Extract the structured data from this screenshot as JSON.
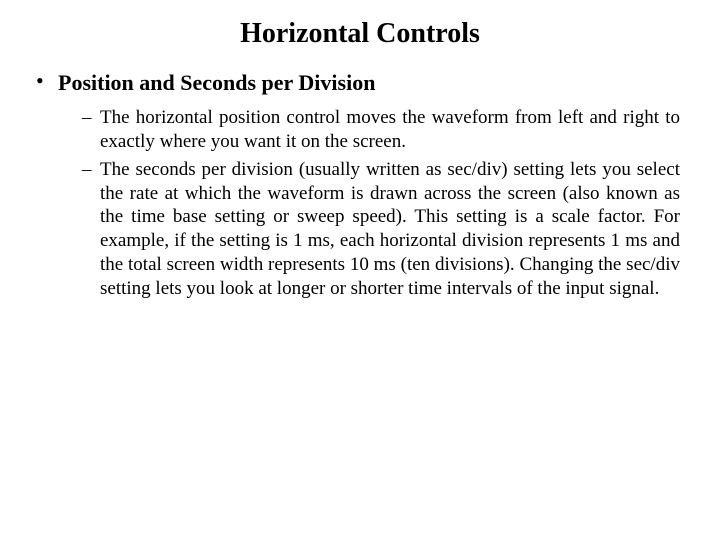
{
  "title": "Horizontal Controls",
  "bullets": {
    "item1": {
      "heading": "Position and Seconds per Division",
      "sub1": "The horizontal position control moves the waveform from left and right to exactly where you want it on the screen.",
      "sub2": "The seconds per division (usually written as sec/div) setting lets you select the rate at which the waveform is drawn across the screen (also known as the time base setting or sweep speed). This setting is a scale factor. For example, if the setting is 1 ms, each horizontal division represents 1 ms and the total screen width represents 10 ms (ten divisions). Changing the sec/div setting lets you look at longer or shorter time intervals of the input signal."
    }
  }
}
